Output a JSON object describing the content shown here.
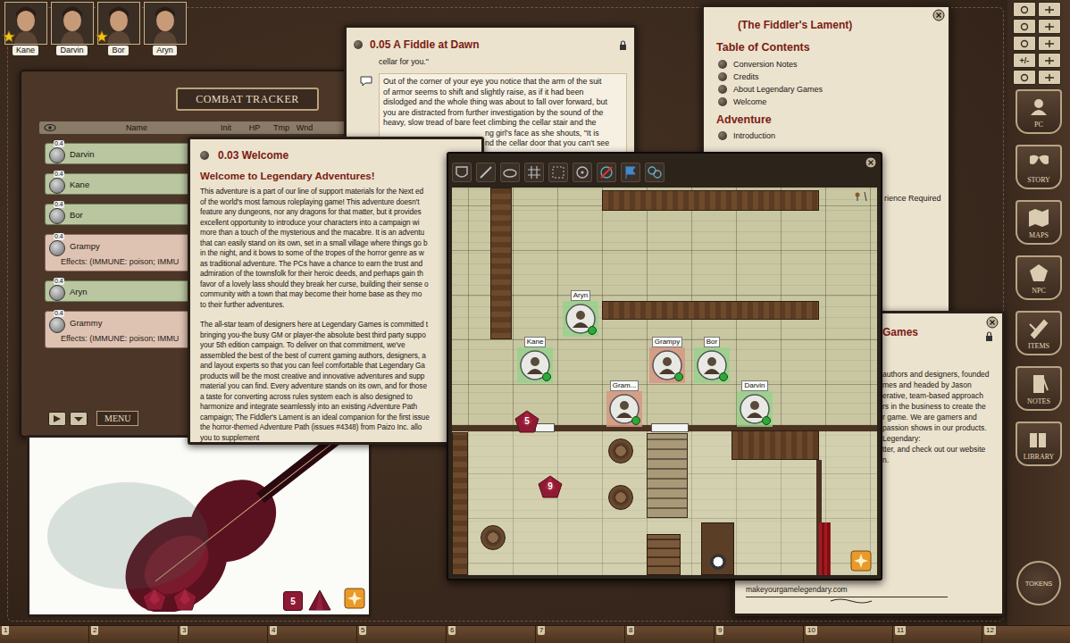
{
  "portraits": [
    {
      "name": "Kane",
      "starred": true
    },
    {
      "name": "Darvin",
      "starred": false
    },
    {
      "name": "Bor",
      "starred": true
    },
    {
      "name": "Aryn",
      "starred": false
    }
  ],
  "combat_tracker": {
    "title": "COMBAT TRACKER",
    "columns": [
      "Name",
      "Init",
      "HP",
      "Tmp",
      "Wnd"
    ],
    "rows": [
      {
        "name": "Darvin",
        "badge": "0.4",
        "kind": "friend"
      },
      {
        "name": "Kane",
        "badge": "0.4",
        "kind": "friend"
      },
      {
        "name": "Bor",
        "badge": "0.4",
        "kind": "friend"
      },
      {
        "name": "Grampy",
        "badge": "0.4",
        "kind": "foe",
        "effects": "Effects: (IMMUNE: poison; IMMU"
      },
      {
        "name": "Aryn",
        "badge": "0.4",
        "kind": "friend"
      },
      {
        "name": "Grammy",
        "badge": "0.4",
        "kind": "foe",
        "effects": "Effects: (IMMUNE: poison; IMMU"
      }
    ],
    "menu": "MENU"
  },
  "dice_tray": {
    "dice": [
      {
        "kind": "d10"
      },
      {
        "kind": "d10"
      },
      {
        "kind": "d6",
        "value": "5"
      },
      {
        "kind": "d4"
      }
    ]
  },
  "story_window": {
    "title": "0.05 A Fiddle at Dawn",
    "intro": "cellar for you.\"",
    "lines": [
      "Out of the corner of your eye you notice that the arm of the suit",
      "of armor seems to shift and slightly raise, as if it had been",
      "dislodged and the whole thing was about to fall over forward, but",
      "you are distracted from further investigation by the sound of the",
      "heavy, slow tread of bare feet climbing the cellar stair and the"
    ],
    "cut_lines": [
      "ng girl's face as she shouts, \"It is",
      "nd the cellar door that you can't see"
    ]
  },
  "welcome_window": {
    "title": "0.03 Welcome",
    "heading": "Welcome to Legendary Adventures!",
    "paragraphs": [
      [
        "This adventure is a part of our line of support materials for the Next ed",
        "of the world's most famous roleplaying game! This adventure doesn't",
        "feature any dungeons, nor any dragons for that matter, but it provides",
        "excellent opportunity to introduce your characters into a campaign wi",
        "more than a touch of the mysterious and the macabre. It is an adventu",
        "that can easily stand on its own, set in a small village where things go b",
        "in the night, and it bows to some of the tropes of the horror genre as w",
        "as traditional adventure. The PCs have a chance to earn the trust and",
        "admiration of the townsfolk for their heroic deeds, and perhaps gain th",
        "favor of a lovely lass should they break her curse, building their sense o",
        "community with a town that may become their home base as they mo",
        "to their further adventures."
      ],
      [
        "The all-star team of designers here at Legendary Games is committed t",
        "bringing you-the busy GM or player-the absolute best third party suppo",
        "your 5th edition campaign. To deliver on that commitment, we've",
        "assembled the best of the best of current gaming authors, designers, a",
        "and layout experts so that you can feel comfortable that Legendary Ga",
        "products will be the most creative and innovative adventures and supp",
        "material you can find. Every adventure stands on its own, and for those",
        "a taste for converting across rules system each is also designed to",
        "harmonize and integrate seamlessly into an existing Adventure Path",
        "campaign; The Fiddler's Lament is an ideal companion for the first issue",
        "the horror-themed Adventure Path (issues #4348) from Paizo Inc. allo",
        "you to supplement"
      ]
    ]
  },
  "toc_window": {
    "title": "(The Fiddler's Lament)",
    "heading": "Table of Contents",
    "items": [
      "Conversion Notes",
      "Credits",
      "About Legendary Games",
      "Welcome"
    ],
    "section": "Adventure",
    "section_items": [
      "Introduction"
    ],
    "cut_text": "rience Required"
  },
  "about_window": {
    "title": "Games",
    "lines": [
      "authors and designers, founded",
      "mes and headed by Jason",
      "erative, team-based approach",
      "rs in the business to create the",
      "r game. We are gamers and",
      "passion shows in our products.",
      "Legendary:",
      "tter, and check out our website",
      "n."
    ],
    "website": "makeyourgamelegendary.com"
  },
  "map_window": {
    "tokens": [
      {
        "label": "Aryn",
        "kind": "friend"
      },
      {
        "label": "Kane",
        "kind": "friend"
      },
      {
        "label": "Grampy",
        "kind": "foe"
      },
      {
        "label": "Bor",
        "kind": "friend"
      },
      {
        "label": "Gram...",
        "kind": "foe"
      },
      {
        "label": "Darvin",
        "kind": "friend"
      }
    ],
    "dice": [
      {
        "value": "5"
      },
      {
        "value": "9"
      }
    ]
  },
  "sidebar": {
    "tool_label": "+/-",
    "buttons": [
      "PC",
      "STORY",
      "MAPS",
      "NPC",
      "ITEMS",
      "NOTES",
      "LIBRARY"
    ],
    "tokens_button": "TOKENS"
  },
  "hotkeys": [
    "1",
    "2",
    "3",
    "4",
    "5",
    "6",
    "7",
    "8",
    "9",
    "10",
    "11",
    "12"
  ]
}
